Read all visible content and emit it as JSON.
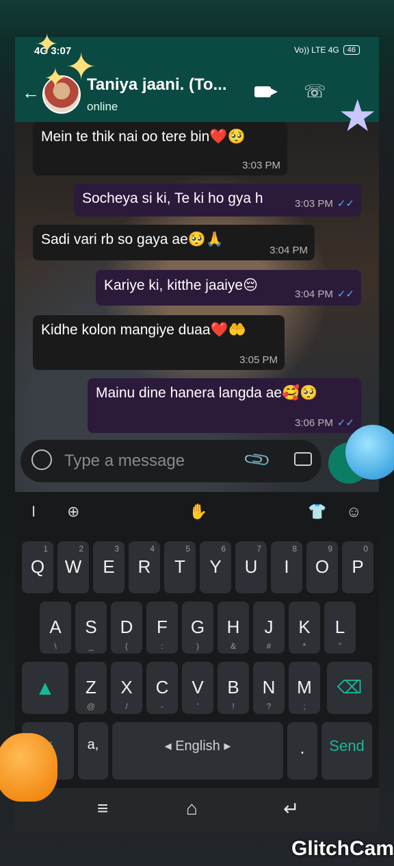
{
  "status_bar": {
    "signal": "4G",
    "time": "3:07",
    "network": "Vo)) LTE 4G",
    "battery": "46"
  },
  "header": {
    "name": "Taniya jaani. (To...",
    "status": "online",
    "back_icon": "arrow-back-icon",
    "video_icon": "video-call-icon",
    "phone_icon": "phone-icon"
  },
  "messages": [
    {
      "direction": "in",
      "text": "Mein te thik nai oo tere bin❤️🥺",
      "time": "3:03 PM"
    },
    {
      "direction": "out",
      "text": "Socheya si ki, Te ki ho gya h",
      "time": "3:03 PM",
      "ticks": "✓✓"
    },
    {
      "direction": "in",
      "text": "Sadi vari rb so gaya ae🥺🙏",
      "time": "3:04 PM"
    },
    {
      "direction": "out",
      "text": "Kariye ki, kitthe jaaiye😔",
      "time": "3:04 PM",
      "ticks": "✓✓"
    },
    {
      "direction": "in",
      "text": "Kidhe kolon mangiye duaa❤️🤲",
      "time": "3:05 PM"
    },
    {
      "direction": "out",
      "text": "Mainu dine hanera langda ae🥰🥺",
      "time": "3:06 PM",
      "ticks": "✓✓"
    }
  ],
  "composer": {
    "placeholder": "Type a message"
  },
  "keyboard": {
    "toolbar": [
      "I",
      "⊕",
      "✋",
      "👕",
      "☺"
    ],
    "row1": [
      {
        "main": "Q",
        "sub": "1"
      },
      {
        "main": "W",
        "sub": "2"
      },
      {
        "main": "E",
        "sub": "3"
      },
      {
        "main": "R",
        "sub": "4"
      },
      {
        "main": "T",
        "sub": "5"
      },
      {
        "main": "Y",
        "sub": "6"
      },
      {
        "main": "U",
        "sub": "7"
      },
      {
        "main": "I",
        "sub": "8"
      },
      {
        "main": "O",
        "sub": "9"
      },
      {
        "main": "P",
        "sub": "0"
      }
    ],
    "row2": [
      {
        "main": "A",
        "sub": "\\"
      },
      {
        "main": "S",
        "sub": "_"
      },
      {
        "main": "D",
        "sub": "("
      },
      {
        "main": "F",
        "sub": ":"
      },
      {
        "main": "G",
        "sub": ")"
      },
      {
        "main": "H",
        "sub": "&"
      },
      {
        "main": "J",
        "sub": "#"
      },
      {
        "main": "K",
        "sub": "*"
      },
      {
        "main": "L",
        "sub": "\""
      }
    ],
    "row3": [
      {
        "main": "Z",
        "sub": "@"
      },
      {
        "main": "X",
        "sub": "/"
      },
      {
        "main": "C",
        "sub": "-"
      },
      {
        "main": "V",
        "sub": "'"
      },
      {
        "main": "B",
        "sub": "!"
      },
      {
        "main": "N",
        "sub": "?"
      },
      {
        "main": "M",
        "sub": ";"
      }
    ],
    "row4": {
      "symbols": "#",
      "lang_key": "a,",
      "space": "English",
      "period": ".",
      "send": "Send"
    }
  },
  "nav": {
    "menu": "≡",
    "home": "⌂",
    "back": "↵"
  },
  "watermark": "GlitchCam",
  "colors": {
    "header_bg": "#0b4a42",
    "accent_green": "#0b7d62",
    "read_tick": "#5aa7ff",
    "shift": "#19b79b"
  }
}
